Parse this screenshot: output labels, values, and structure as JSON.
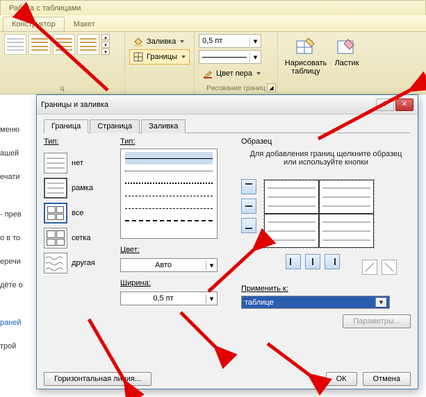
{
  "ribbon": {
    "title": "Работа с таблицами",
    "tabs": {
      "design": "Конструктор",
      "layout": "Макет"
    },
    "fill_btn": "Заливка",
    "borders_btn": "Границы",
    "weight_value": "0,5 пт",
    "pen_color": "Цвет пера",
    "draw_table": "Нарисовать таблицу",
    "eraser": "Ластик",
    "group_draw": "Рисование границ",
    "styles_truncated": "ц"
  },
  "doc_bg": [
    "меню",
    "ашей",
    "ечати",
    "- прев",
    "о в то",
    "еречи",
    "дёте о",
    "раней",
    "трой"
  ],
  "dialog": {
    "title": "Границы и заливка",
    "tabs": {
      "border": "Граница",
      "page": "Страница",
      "fill": "Заливка"
    },
    "type_label": "Тип:",
    "type_none": "нет",
    "type_box": "рамка",
    "type_all": "все",
    "type_grid": "сетка",
    "type_custom": "другая",
    "style_label": "Тип:",
    "color_label": "Цвет:",
    "color_value": "Авто",
    "width_label": "Ширина:",
    "width_value": "0,5 пт",
    "preview_label": "Образец",
    "preview_hint": "Для добавления границ щелкните образец или используйте кнопки",
    "apply_label": "Применить к:",
    "apply_value": "таблице",
    "options_btn": "Параметры...",
    "hline_btn": "Горизонтальная линия...",
    "ok": "ОК",
    "cancel": "Отмена"
  }
}
